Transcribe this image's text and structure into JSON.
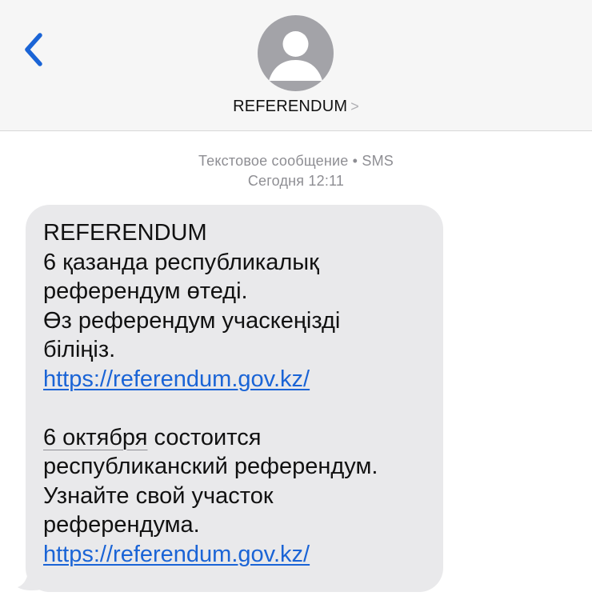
{
  "header": {
    "back_icon": "chevron-left-icon",
    "avatar_icon": "person-icon",
    "contact_name": "REFERENDUM",
    "contact_chevron": ">",
    "accent_color": "#1a64d6"
  },
  "conversation": {
    "message_type": "Текстовое сообщение • SMS",
    "timestamp": "Сегодня 12:11"
  },
  "message": {
    "sender_line": "REFERENDUM",
    "kz_line1": "6 қазанда республикалық",
    "kz_line2": "референдум өтеді.",
    "kz_line3": "Өз референдум учаскеңізді",
    "kz_line4": "біліңіз.",
    "link1": "https://referendum.gov.kz/",
    "ru_date": "6 октября",
    "ru_line1_rest": " состоится",
    "ru_line2": "республиканский референдум.",
    "ru_line3": "Узнайте свой участок",
    "ru_line4": "референдума.",
    "link2": "https://referendum.gov.kz/",
    "bubble_color": "#e9e9eb"
  }
}
